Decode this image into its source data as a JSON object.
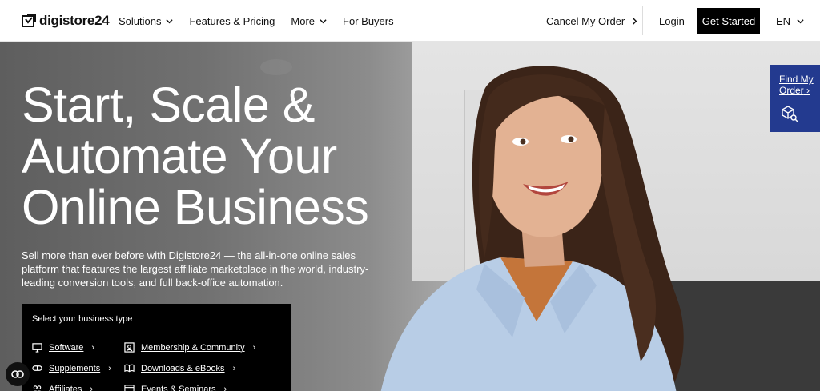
{
  "header": {
    "brand": "digistore24",
    "nav": [
      {
        "label": "Solutions",
        "has_dropdown": true
      },
      {
        "label": "Features & Pricing",
        "has_dropdown": false
      },
      {
        "label": "More",
        "has_dropdown": true
      },
      {
        "label": "For Buyers",
        "has_dropdown": false
      }
    ],
    "cancel_order": "Cancel My Order",
    "login": "Login",
    "get_started": "Get Started",
    "language": "EN"
  },
  "hero": {
    "title_line1": "Start, Scale &",
    "title_line2": "Automate Your",
    "title_line3": "Online Business",
    "subtitle": "Sell more than ever before with Digistore24 — the all-in-one online sales platform that features the largest affiliate marketplace in the world, industry-leading conversion tools, and full back-office automation."
  },
  "business_type": {
    "title": "Select your business type",
    "items": [
      {
        "label": "Software",
        "icon": "monitor-icon"
      },
      {
        "label": "Membership & Community",
        "icon": "member-icon"
      },
      {
        "label": "Supplements",
        "icon": "capsule-icon"
      },
      {
        "label": "Downloads & eBooks",
        "icon": "book-icon"
      },
      {
        "label": "Affiliates",
        "icon": "people-icon"
      },
      {
        "label": "Events & Seminars",
        "icon": "calendar-icon"
      }
    ]
  },
  "find_order": {
    "label_line1": "Find My",
    "label_line2": "Order"
  },
  "colors": {
    "accent": "#233a8f",
    "cta": "#000000"
  }
}
